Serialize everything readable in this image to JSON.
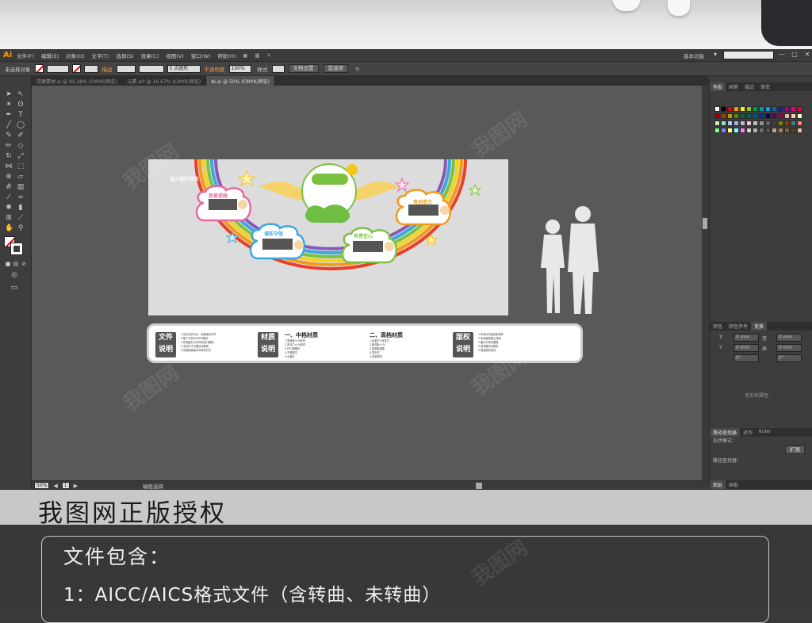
{
  "menubar": {
    "app_icon": "Ai",
    "items": [
      "文件(F)",
      "编辑(E)",
      "对象(O)",
      "文字(T)",
      "选择(S)",
      "效果(C)",
      "视图(V)",
      "窗口(W)",
      "帮助(H)"
    ],
    "workspace": "基本功能",
    "win_min": "—",
    "win_max": "□",
    "win_close": "✕"
  },
  "control_bar": {
    "selection": "未选择对象",
    "stroke_label": "描边",
    "brush_value": "5 点圆形",
    "opacity_label": "不透明度",
    "opacity_value": "100%",
    "style_label": "样式",
    "doc_setup": "文档设置",
    "preferences": "首选项"
  },
  "tabs": [
    {
      "label": "党建素材.ai @ 95.29% (CMYK/预览)",
      "active": false
    },
    {
      "label": "元素.ai* @ 16.67% (CMYK/预览)",
      "active": false
    },
    {
      "label": "AI.ai @ 50% (CMYK/预览)",
      "active": true
    }
  ],
  "statusbar": {
    "zoom": "50%",
    "page": "1",
    "label": "编组选择"
  },
  "artboard": {
    "badge_top": "幼儿园代用名",
    "cloud1": "热爱祖国",
    "cloud2": "诚实守信",
    "cloud3": "有责任心",
    "cloud4": "有创造力"
  },
  "info": {
    "tag1_line1": "文件",
    "tag1_line2": "说明",
    "tag1_text": [
      "1.设计文件为AI，请使用AI打开",
      "2.整个文件为CMYK格式",
      "3.所有图片与字体请自行替换",
      "4.文件尺寸可按比例修改",
      "5.请使用高版本AI软件打开"
    ],
    "tag2_line1": "材质",
    "tag2_line2": "说明",
    "mid_head": "一、中档材质",
    "mid_text": [
      "1.雪弗板+UV彩印",
      "2.亚克力+UV彩印",
      "3.PVC板雕刻",
      "4.不锈钢字",
      "5.水晶字"
    ],
    "high_head": "二、高档材质",
    "high_text": [
      "1.钛金字+亚克力",
      "2.烤漆板+UV",
      "3.铝塑板造型",
      "4.发光字",
      "5.定制材料"
    ],
    "tag3_line1": "版权",
    "tag3_line2": "说明",
    "tag3_text": [
      "1.本设计作品仅供参考",
      "2.未经授权禁止商用",
      "3.图片字体请替换",
      "4.如有疑问请联系",
      "5.感谢您的支持"
    ]
  },
  "right_panel": {
    "swatch_tabs": [
      "色板",
      "画笔",
      "描边",
      "渐变"
    ],
    "color_tabs": [
      "颜色",
      "颜色参考",
      "变换"
    ],
    "transform_x_label": "X",
    "transform_y_label": "Y",
    "transform_w_label": "宽",
    "transform_h_label": "高",
    "transform_x": "0 mm",
    "transform_y": "0 mm",
    "transform_w": "0 mm",
    "transform_h": "0 mm",
    "angle1": "0°",
    "angle2": "0°",
    "no_shape": "无形状属性",
    "pathfinder_tabs": [
      "路径查找器",
      "对齐",
      "Kuler"
    ],
    "shape_mode": "形状模式：",
    "expand": "扩展",
    "pathfinder": "路径查找器：",
    "bottom_tabs": [
      "图层",
      "画板"
    ]
  },
  "banner_title": "我图网正版授权",
  "includes": {
    "title": "文件包含：",
    "line1": "1：AICC/AICS格式文件（含转曲、未转曲）"
  },
  "watermark": "我图网",
  "colors": {
    "accent_orange": "#ff9a00",
    "canvas": "#595959",
    "panel": "#3d3d3d"
  }
}
